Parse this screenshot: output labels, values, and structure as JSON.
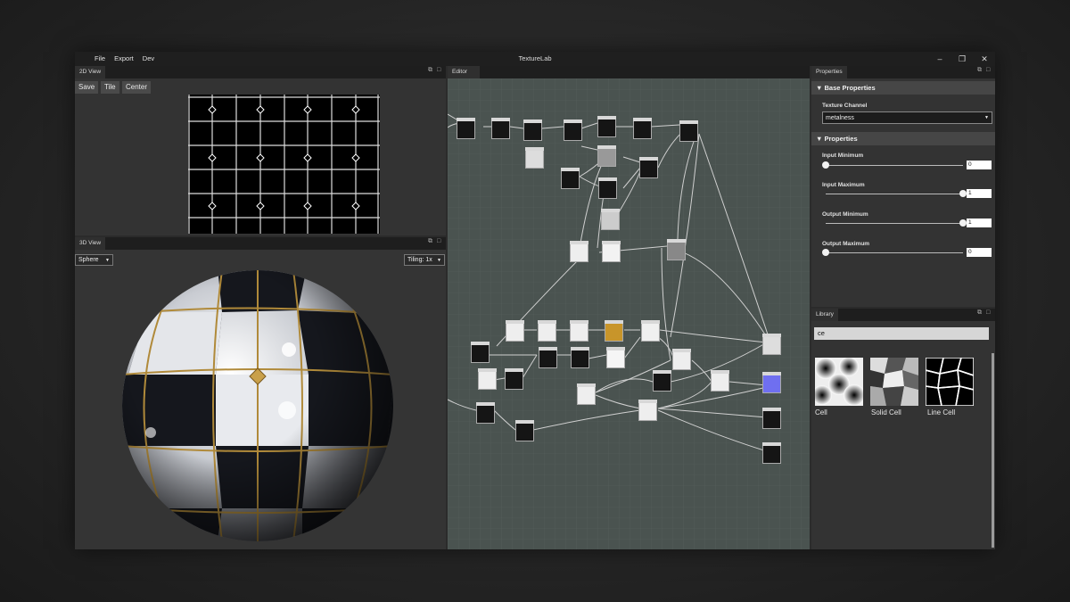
{
  "app": {
    "title": "TextureLab",
    "menu": [
      "File",
      "Export",
      "Dev"
    ]
  },
  "panels": {
    "view2d": {
      "tab": "2D View",
      "buttons": [
        "Save",
        "Tile",
        "Center"
      ]
    },
    "view3d": {
      "tab": "3D View",
      "shape": "Sphere",
      "tiling": "Tiling: 1x"
    },
    "editor": {
      "tab": "Editor"
    },
    "properties": {
      "tab": "Properties",
      "base_section": "Base Properties",
      "texture_channel_label": "Texture Channel",
      "texture_channel_value": "metalness",
      "props_section": "Properties",
      "fields": [
        {
          "label": "Input Minimum",
          "value": "0",
          "slider": 0.0
        },
        {
          "label": "Input Maximum",
          "value": "1",
          "slider": 1.0
        },
        {
          "label": "Output Minimum",
          "value": "1",
          "slider": 1.0
        },
        {
          "label": "Output Maximum",
          "value": "0",
          "slider": 0.0
        }
      ]
    },
    "library": {
      "tab": "Library",
      "search_value": "ce",
      "items": [
        "Cell",
        "Solid Cell",
        "Line Cell"
      ]
    }
  },
  "colors": {
    "accent_node": "#c8952a",
    "accent_blue": "#6f6ff0",
    "editor_bg": "#4a5350"
  }
}
